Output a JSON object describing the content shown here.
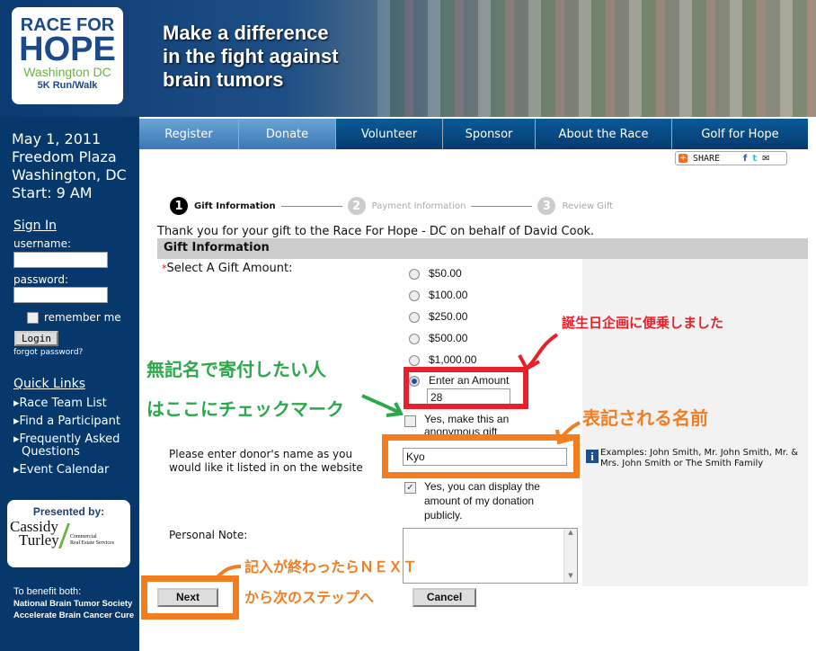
{
  "header": {
    "logo": {
      "line1": "RACE FOR",
      "line2": "HOPE",
      "line3": "Washington DC",
      "line4": "5K Run/Walk"
    },
    "tagline": [
      "Make a difference",
      "in the fight against",
      "brain tumors"
    ]
  },
  "nav": [
    "Register",
    "Donate",
    "Volunteer",
    "Sponsor",
    "About the Race",
    "Golf for Hope"
  ],
  "share": {
    "label": "SHARE"
  },
  "sidebar": {
    "event": [
      "May 1, 2011",
      "Freedom Plaza",
      "Washington, DC",
      "Start: 9 AM"
    ],
    "sign_in": "Sign In",
    "username_label": "username:",
    "password_label": "password:",
    "remember": "remember me",
    "login": "Login",
    "forgot": "forgot password?",
    "quick_links_title": "Quick Links",
    "quick_links": [
      "Race Team List",
      "Find a Participant",
      "Frequently Asked Questions",
      "Event Calendar"
    ],
    "presented_by": "Presented by:",
    "sponsor": {
      "name1": "Cassidy",
      "name2": "Turley",
      "sub1": "Commercial",
      "sub2": "Real Estate Services"
    },
    "benefit": "To benefit both:",
    "benefit_orgs": [
      "National Brain Tumor Society",
      "Accelerate Brain Cancer Cure"
    ]
  },
  "steps": [
    {
      "num": "1",
      "label": "Gift Information"
    },
    {
      "num": "2",
      "label": "Payment Information"
    },
    {
      "num": "3",
      "label": "Review Gift"
    }
  ],
  "form": {
    "thanks": "Thank you for your gift to the Race For Hope - DC on behalf of David Cook.",
    "section": "Gift Information",
    "amount_label": "Select A Gift Amount:",
    "required": "*",
    "amounts": [
      "$50.00",
      "$100.00",
      "$250.00",
      "$500.00",
      "$1,000.00",
      "Enter an Amount"
    ],
    "selected": "Enter an Amount",
    "custom_amount": "28",
    "anonymous": "Yes, make this an anonymous gift",
    "anonymous_checked": false,
    "donor_label": "Please enter donor's name as you would like it listed in on the website",
    "donor_value": "Kyo",
    "examples": "Examples: John Smith, Mr. John Smith, Mr. & Mrs. John Smith or The Smith Family",
    "display_amount": "Yes, you can display the amount of my donation publicly.",
    "display_checked": true,
    "note_label": "Personal Note:",
    "note_value": "",
    "next": "Next",
    "cancel": "Cancel"
  },
  "annotations": {
    "red": "誕生日企画に便乗しました",
    "green1": "無記名で寄付したい人",
    "green2": "はここにチェックマーク",
    "orange_name": "表記される名前",
    "orange_next1": "記入が終わったらＮＥＸＴ",
    "orange_next2": "から次のステップへ",
    "colors": {
      "red": "#e8202a",
      "green": "#2aa84a",
      "orange": "#f47d20"
    }
  }
}
